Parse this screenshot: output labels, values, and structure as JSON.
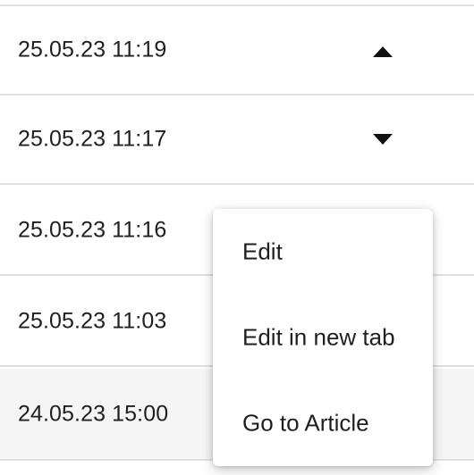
{
  "rows": [
    {
      "date": "25.05.23 11:19",
      "caret": "caret-up-icon"
    },
    {
      "date": "25.05.23 11:17",
      "caret": "caret-down-icon"
    },
    {
      "date": "25.05.23 11:16"
    },
    {
      "date": "25.05.23 11:03"
    },
    {
      "date": "24.05.23 15:00"
    }
  ],
  "context_menu": {
    "items": [
      {
        "label": "Edit"
      },
      {
        "label": "Edit in new tab"
      },
      {
        "label": "Go to Article"
      }
    ]
  }
}
